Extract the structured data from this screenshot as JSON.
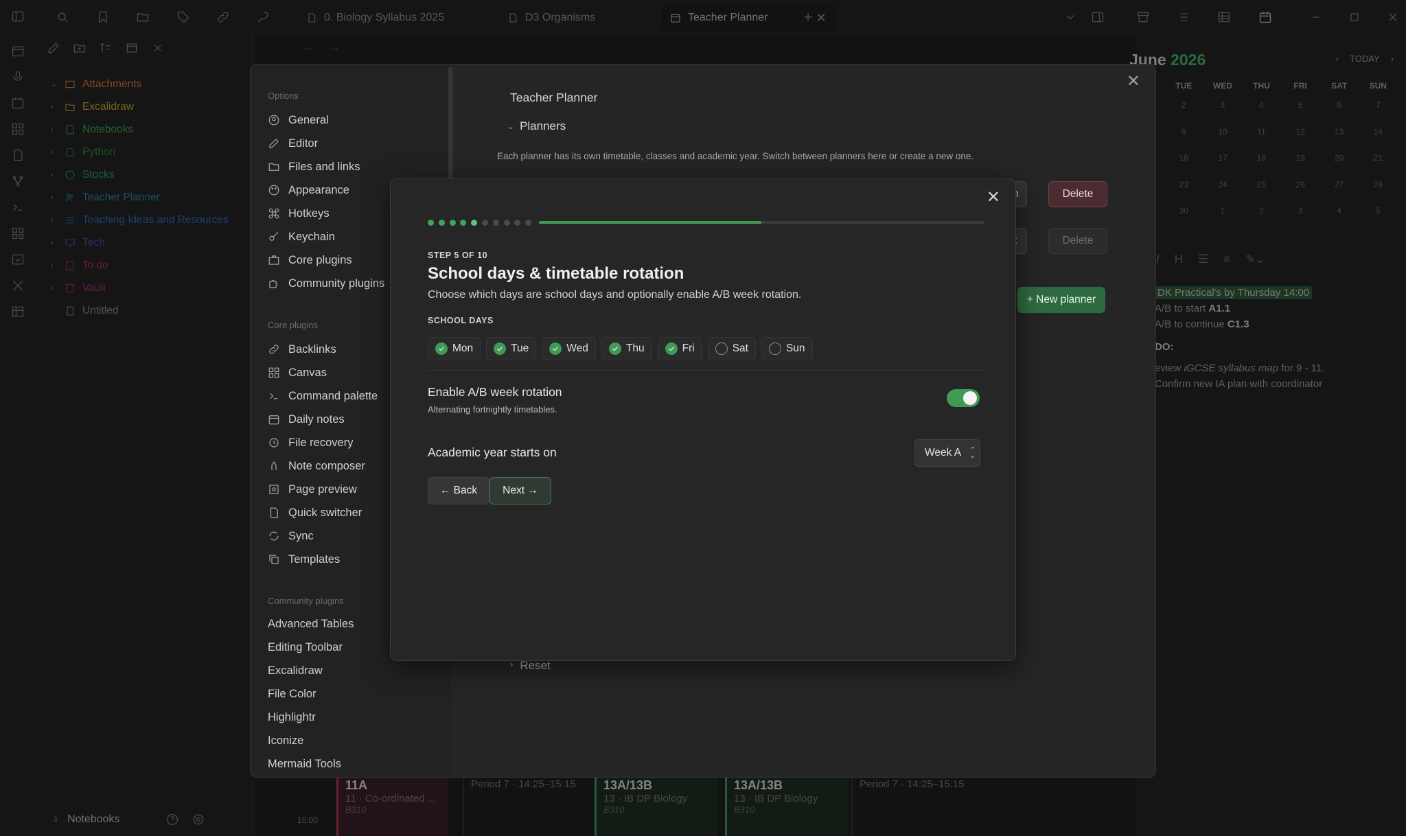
{
  "tabs": [
    {
      "label": "0. Biology Syllabus 2025"
    },
    {
      "label": "D3 Organisms"
    },
    {
      "label": "Teacher Planner"
    }
  ],
  "sidebar": {
    "items": [
      {
        "label": "Attachments",
        "color": "#d97c3a"
      },
      {
        "label": "Excalidraw",
        "color": "#c9a42c"
      },
      {
        "label": "Notebooks",
        "color": "#3fa34a"
      },
      {
        "label": "Python",
        "color": "#2e8b3d"
      },
      {
        "label": "Stocks",
        "color": "#2a9e6e"
      },
      {
        "label": "Teacher Planner",
        "color": "#2f7fa6"
      },
      {
        "label": "Teaching Ideas and Resources",
        "color": "#2b6fc2"
      },
      {
        "label": "Tech",
        "color": "#6a3aa8"
      },
      {
        "label": "To do",
        "color": "#b0344a"
      },
      {
        "label": "Vault",
        "color": "#b02a8a"
      },
      {
        "label": "Untitled",
        "color": "#8a8a8a"
      }
    ],
    "footer_label": "Notebooks"
  },
  "calendar": {
    "month": "June",
    "year": "2026",
    "today_label": "TODAY",
    "days": [
      "TUE",
      "WED",
      "THU",
      "FRI",
      "SAT",
      "SUN"
    ],
    "dates": [
      "2",
      "3",
      "4",
      "5",
      "6",
      "7",
      "9",
      "10",
      "11",
      "12",
      "13",
      "14",
      "16",
      "17",
      "18",
      "19",
      "20",
      "21",
      "23",
      "24",
      "25",
      "26",
      "27",
      "28",
      "30",
      "1",
      "2",
      "3",
      "4",
      "5"
    ]
  },
  "notes": {
    "line1": "DK Practical's by Thursday 14:00",
    "line2_pre": "A/B to start ",
    "line2_b": "A1.1",
    "line3_pre": "A/B to continue ",
    "line3_b": "C1.3",
    "heading": "DO:",
    "line4_pre": "eview ",
    "line4_em": "iGCSE syllabus map",
    "line4_post": " for 9 - 11.",
    "line5": "Confirm new IA plan with coordinator"
  },
  "strip": {
    "time": "15:00",
    "cards": [
      {
        "cls": "11A",
        "sub": "11 · Co-ordinated ...",
        "room": "B310",
        "color": "#3a1f2a"
      },
      {
        "cls": "",
        "sub": "Period 7 · 14:25–15:15",
        "room": "",
        "color": "#1f1f1f"
      },
      {
        "cls": "13A/13B",
        "sub": "13 · IB DP Biology",
        "room": "B310",
        "color": "#1f2e22"
      },
      {
        "cls": "13A/13B",
        "sub": "13 · IB DP Biology",
        "room": "B310",
        "color": "#1f2e22"
      },
      {
        "cls": "",
        "sub": "Period 7 · 14:25–15:15",
        "room": "",
        "color": "#1f1f1f"
      }
    ]
  },
  "settings": {
    "options_heading": "Options",
    "options": [
      "General",
      "Editor",
      "Files and links",
      "Appearance",
      "Hotkeys",
      "Keychain",
      "Core plugins",
      "Community plugins"
    ],
    "core_heading": "Core plugins",
    "core": [
      "Backlinks",
      "Canvas",
      "Command palette",
      "Daily notes",
      "File recovery",
      "Note composer",
      "Page preview",
      "Quick switcher",
      "Sync",
      "Templates"
    ],
    "community_heading": "Community plugins",
    "community": [
      "Advanced Tables",
      "Editing Toolbar",
      "Excalidraw",
      "File Color",
      "Highlightr",
      "Iconize",
      "Mermaid Tools"
    ],
    "title": "Teacher Planner",
    "planners_heading": "Planners",
    "planners_desc": "Each planner has its own timetable, classes and academic year. Switch between planners here or create a new one.",
    "switch_label": "tch",
    "delete_label": "Delete",
    "edit_label": "dit",
    "delete2_label": "Delete",
    "new_planner_label": "+ New planner",
    "reset_label": "Reset"
  },
  "wizard": {
    "step_label": "STEP 5 OF 10",
    "title": "School days & timetable rotation",
    "description": "Choose which days are school days and optionally enable A/B week rotation.",
    "days_heading": "SCHOOL DAYS",
    "days": [
      {
        "label": "Mon",
        "checked": true
      },
      {
        "label": "Tue",
        "checked": true
      },
      {
        "label": "Wed",
        "checked": true
      },
      {
        "label": "Thu",
        "checked": true
      },
      {
        "label": "Fri",
        "checked": true
      },
      {
        "label": "Sat",
        "checked": false
      },
      {
        "label": "Sun",
        "checked": false
      }
    ],
    "rotation_title": "Enable A/B week rotation",
    "rotation_desc": "Alternating fortnightly timetables.",
    "rotation_enabled": true,
    "academic_label": "Academic year starts on",
    "academic_value": "Week A",
    "back_label": "← Back",
    "next_label": "Next →",
    "current_step": 5,
    "total_steps": 10,
    "accent": "#3f9a56"
  }
}
